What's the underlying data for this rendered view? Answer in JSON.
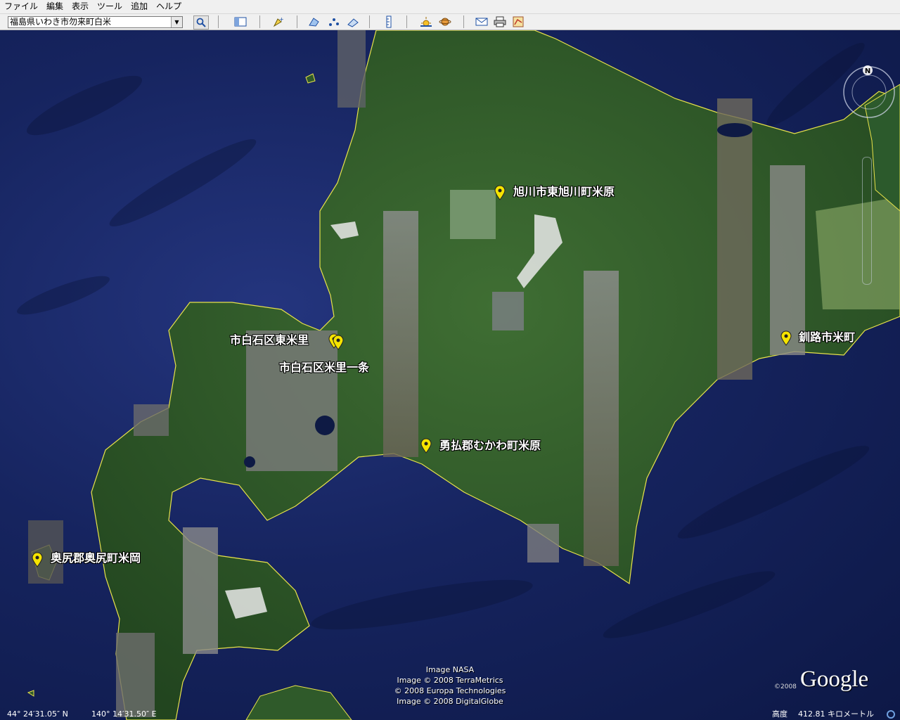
{
  "menu": [
    "ファイル",
    "編集",
    "表示",
    "ツール",
    "追加",
    "ヘルプ"
  ],
  "search": {
    "value": "福島県いわき市勿来町白米"
  },
  "icons": [
    "search-icon",
    "sidebar-icon",
    "placemark-icon",
    "polygon-icon",
    "path-icon",
    "image-overlay-icon",
    "ruler-icon",
    "sun-icon",
    "planet-icon",
    "email-icon",
    "print-icon",
    "maps-icon"
  ],
  "placemarks": [
    {
      "label": "旭川市東旭川町米原"
    },
    {
      "label": "市白石区東米里"
    },
    {
      "label": "市白石区米里一条"
    },
    {
      "label": "釧路市米町"
    },
    {
      "label": "勇払郡むかわ町米原"
    },
    {
      "label": "奥尻郡奥尻町米岡"
    }
  ],
  "credits": [
    "Image NASA",
    "Image © 2008 TerraMetrics",
    "© 2008 Europa Technologies",
    "Image © 2008 DigitalGlobe"
  ],
  "logo": {
    "copyright": "©2008",
    "name": "Google"
  },
  "status": {
    "lat": "44° 24′31.05″ N",
    "lon": "140° 14′31.50″ E",
    "alt_label": "高度",
    "alt_value": "412.81 キロメートル"
  },
  "compass": {
    "north": "N"
  },
  "colors": {
    "coastline": "#e8e24a",
    "sea": "#16245f",
    "land": "#2f5a2a",
    "pin": "#f5e400"
  }
}
